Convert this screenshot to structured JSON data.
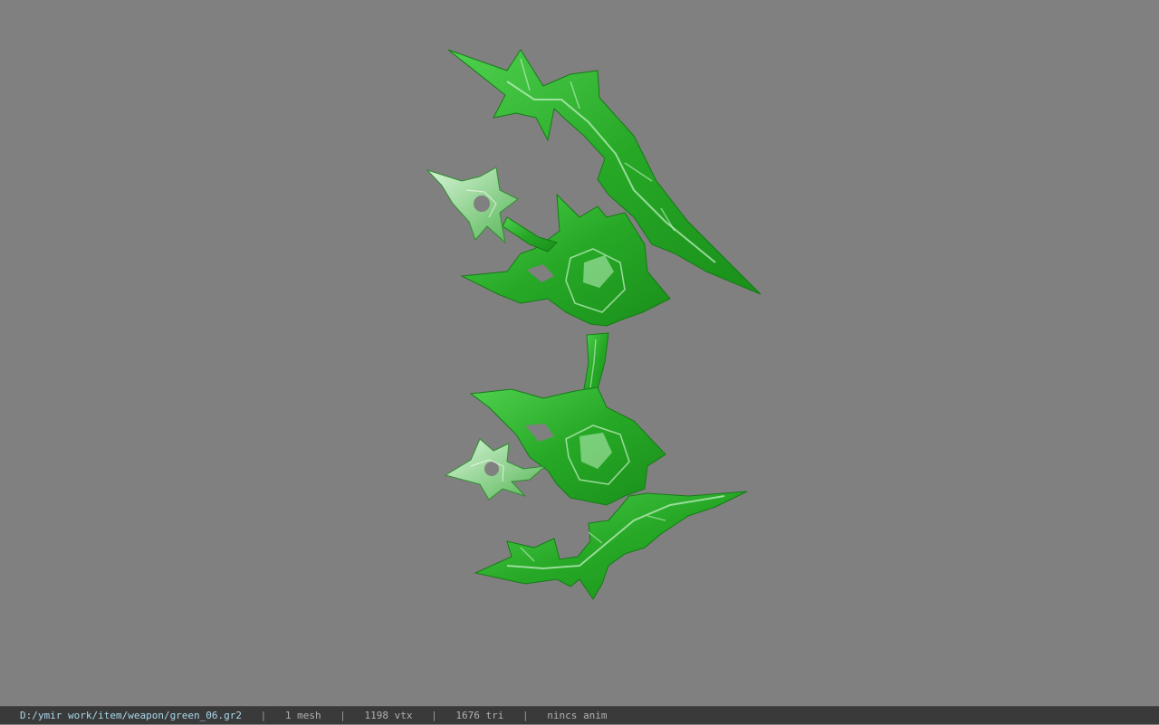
{
  "viewer": {
    "background_color": "#808080",
    "model_color": "#2fb52f",
    "model_highlight_color": "#bff0bf",
    "model_name": "green_06"
  },
  "statusbar": {
    "file_path": "D:/ymir work/item/weapon/green_06.gr2",
    "separator": "|",
    "mesh_count": "1 mesh",
    "vertex_count": "1198 vtx",
    "triangle_count": "1676 tri",
    "animation": "nincs anim"
  }
}
